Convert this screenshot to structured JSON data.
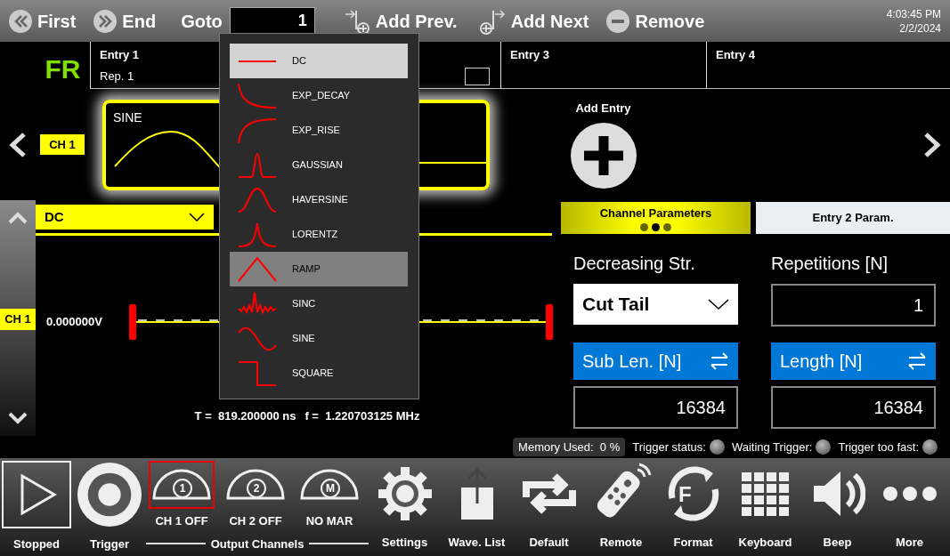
{
  "toolbar": {
    "buttons": [
      {
        "kind": "first",
        "label": "First"
      },
      {
        "kind": "end",
        "label": "End"
      },
      {
        "kind": "goto",
        "label": "Goto",
        "value": "1"
      },
      {
        "kind": "add_prev",
        "label": "Add Prev."
      },
      {
        "kind": "add_next",
        "label": "Add Next"
      },
      {
        "kind": "remove",
        "label": "Remove"
      }
    ],
    "clock": {
      "time": "4:03:45 PM",
      "date": "2/2/2024"
    }
  },
  "sequence": {
    "mode": "FR",
    "channel_tag": "CH 1",
    "entries": [
      {
        "label": "Entry 1",
        "repetitions": "Rep. 1"
      },
      {
        "label": "Entry 3"
      },
      {
        "label": "Entry 4"
      }
    ],
    "card": {
      "waveform": "SINE"
    },
    "add_entry": {
      "label": "Add Entry"
    }
  },
  "editor": {
    "channel_tag": "CH 1",
    "waveform_select": {
      "value": "DC"
    },
    "level_label": "0.000000V",
    "period": "T =  819.200000 ns",
    "frequency": "f =  1.220703125 MHz"
  },
  "waveform_menu": [
    {
      "kind": "dc",
      "label": "DC",
      "selected": true,
      "hovered": false
    },
    {
      "kind": "exp_decay",
      "label": "EXP_DECAY",
      "selected": false,
      "hovered": false
    },
    {
      "kind": "exp_rise",
      "label": "EXP_RISE",
      "selected": false,
      "hovered": false
    },
    {
      "kind": "gaussian",
      "label": "GAUSSIAN",
      "selected": false,
      "hovered": false
    },
    {
      "kind": "haversine",
      "label": "HAVERSINE",
      "selected": false,
      "hovered": false
    },
    {
      "kind": "lorentz",
      "label": "LORENTZ",
      "selected": false,
      "hovered": false
    },
    {
      "kind": "ramp",
      "label": "RAMP",
      "selected": false,
      "hovered": true
    },
    {
      "kind": "sinc",
      "label": "SINC",
      "selected": false,
      "hovered": false
    },
    {
      "kind": "sine",
      "label": "SINE",
      "selected": false,
      "hovered": false
    },
    {
      "kind": "square",
      "label": "SQUARE",
      "selected": false,
      "hovered": false
    }
  ],
  "parameters": {
    "tabs": [
      {
        "label": "Channel Parameters",
        "selected": true
      },
      {
        "label": "Entry 2 Param.",
        "selected": false
      }
    ],
    "pages": [
      {
        "selected": false
      },
      {
        "selected": true
      },
      {
        "selected": false
      }
    ],
    "decreasing": {
      "label": "Decreasing Str.",
      "value": "Cut Tail"
    },
    "repetitions": {
      "label": "Repetitions [N]",
      "value": "1"
    },
    "sub_length": {
      "label": "Sub Len. [N]",
      "value": "16384"
    },
    "length": {
      "label": "Length [N]",
      "value": "16384"
    }
  },
  "status_bar": {
    "memory": {
      "label": "Memory Used:",
      "value": "0 %"
    },
    "indicators": [
      {
        "label": "Trigger status:",
        "on": false
      },
      {
        "label": "Waiting Trigger:",
        "on": false
      },
      {
        "label": "Trigger too fast:",
        "on": false
      }
    ]
  },
  "bottom_bar": {
    "run_tools": [
      {
        "kind": "play",
        "label": "Stopped",
        "focused": true
      },
      {
        "kind": "record",
        "label": "Trigger",
        "focused": false
      }
    ],
    "output_channels": {
      "label": "Output Channels",
      "channels": [
        {
          "badge": "1",
          "label": "CH 1 OFF",
          "selected": true
        },
        {
          "badge": "2",
          "label": "CH 2 OFF",
          "selected": false
        },
        {
          "badge": "M",
          "label": "NO MAR",
          "selected": false
        }
      ]
    },
    "tools": [
      {
        "kind": "gear",
        "label": "Settings"
      },
      {
        "kind": "upload",
        "label": "Wave. List"
      },
      {
        "kind": "repeat",
        "label": "Default"
      },
      {
        "kind": "remote",
        "label": "Remote"
      },
      {
        "kind": "format",
        "label": "Format",
        "badge": "F"
      },
      {
        "kind": "keyboard",
        "label": "Keyboard"
      },
      {
        "kind": "speaker",
        "label": "Beep"
      },
      {
        "kind": "dots",
        "label": "More"
      }
    ]
  }
}
